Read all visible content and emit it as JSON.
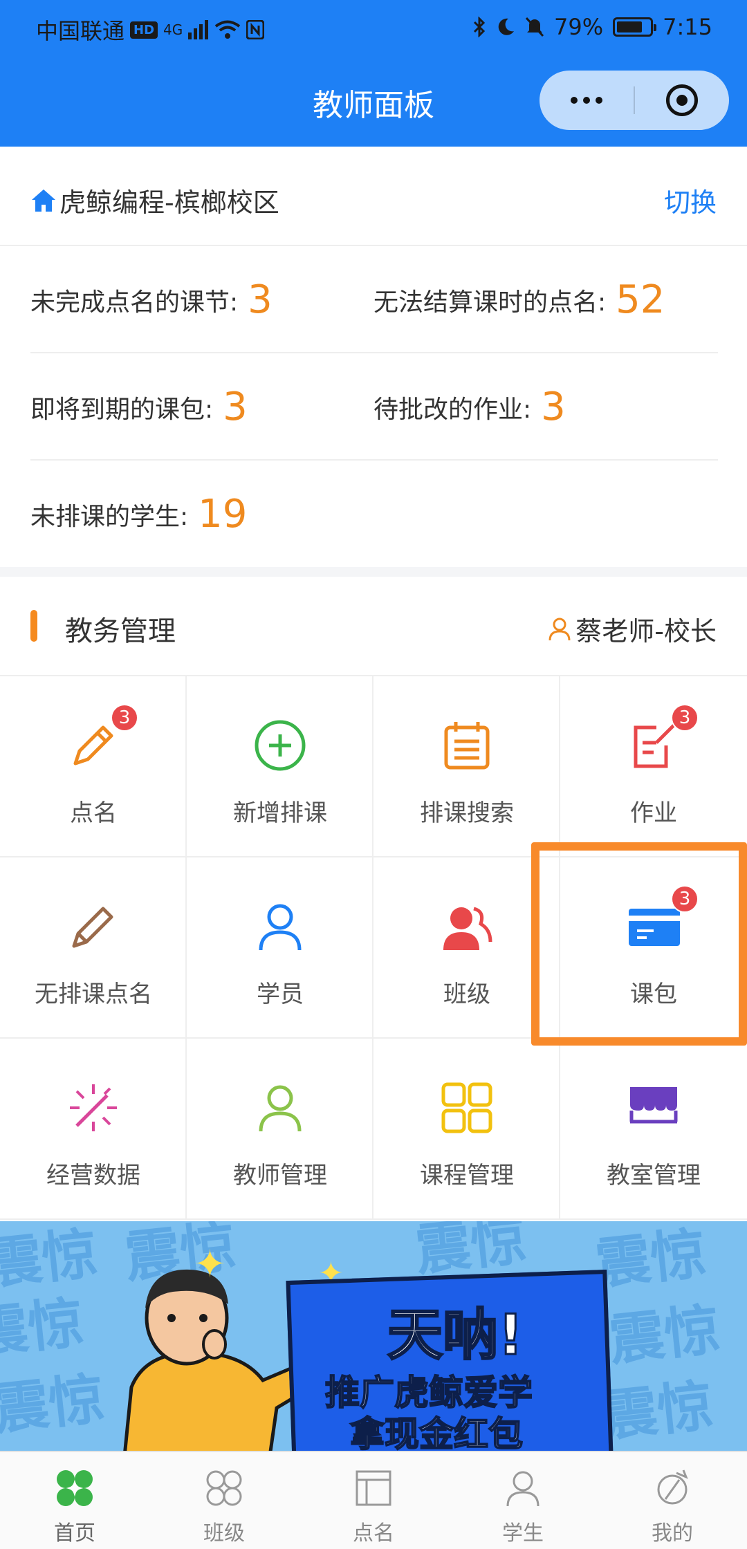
{
  "status_bar": {
    "carrier": "中国联通",
    "hd": "HD",
    "network": "4G",
    "battery_text": "79%",
    "battery_level": 0.79,
    "time": "7:15"
  },
  "nav": {
    "title": "教师面板"
  },
  "campus": {
    "name": "虎鲸编程-槟榔校区",
    "switch_label": "切换"
  },
  "stats": [
    {
      "label": "未完成点名的课节:",
      "value": "3"
    },
    {
      "label": "无法结算课时的点名:",
      "value": "52"
    },
    {
      "label": "即将到期的课包:",
      "value": "3"
    },
    {
      "label": "待批改的作业:",
      "value": "3"
    },
    {
      "label": "未排课的学生:",
      "value": "19"
    }
  ],
  "section": {
    "title": "教务管理",
    "user": "蔡老师-校长"
  },
  "grid": [
    {
      "label": "点名",
      "icon": "pencil-icon",
      "badge": "3",
      "color": "#ef8a1f"
    },
    {
      "label": "新增排课",
      "icon": "plus-circle-icon",
      "badge": "",
      "color": "#3bb44a"
    },
    {
      "label": "排课搜索",
      "icon": "calendar-icon",
      "badge": "",
      "color": "#ef8a1f"
    },
    {
      "label": "作业",
      "icon": "edit-note-icon",
      "badge": "3",
      "color": "#e8484a"
    },
    {
      "label": "无排课点名",
      "icon": "pencil-outline-icon",
      "badge": "",
      "color": "#9a6a4a"
    },
    {
      "label": "学员",
      "icon": "person-icon",
      "badge": "",
      "color": "#1e80f5"
    },
    {
      "label": "班级",
      "icon": "group-icon",
      "badge": "",
      "color": "#e8484a"
    },
    {
      "label": "课包",
      "icon": "card-icon",
      "badge": "3",
      "color": "#1e80f5"
    },
    {
      "label": "经营数据",
      "icon": "sparkle-icon",
      "badge": "",
      "color": "#d9469a"
    },
    {
      "label": "教师管理",
      "icon": "teacher-icon",
      "badge": "",
      "color": "#8bc34a"
    },
    {
      "label": "课程管理",
      "icon": "grid-icon",
      "badge": "",
      "color": "#f2c10f"
    },
    {
      "label": "教室管理",
      "icon": "classroom-icon",
      "badge": "",
      "color": "#6a3fbf"
    }
  ],
  "banner": {
    "bg_word": "震惊",
    "headline": "天呐!",
    "line1": "推广虎鲸爱学",
    "line2": "拿现金红包"
  },
  "tabbar": [
    {
      "label": "首页",
      "icon": "home-icon",
      "active": true
    },
    {
      "label": "班级",
      "icon": "class-icon",
      "active": false
    },
    {
      "label": "点名",
      "icon": "roll-call-icon",
      "active": false
    },
    {
      "label": "学生",
      "icon": "student-icon",
      "active": false
    },
    {
      "label": "我的",
      "icon": "profile-icon",
      "active": false
    }
  ],
  "colors": {
    "primary": "#1e80f5",
    "accent_orange": "#ef8a1f",
    "badge_red": "#e8484a",
    "highlight": "#f88a2b"
  }
}
